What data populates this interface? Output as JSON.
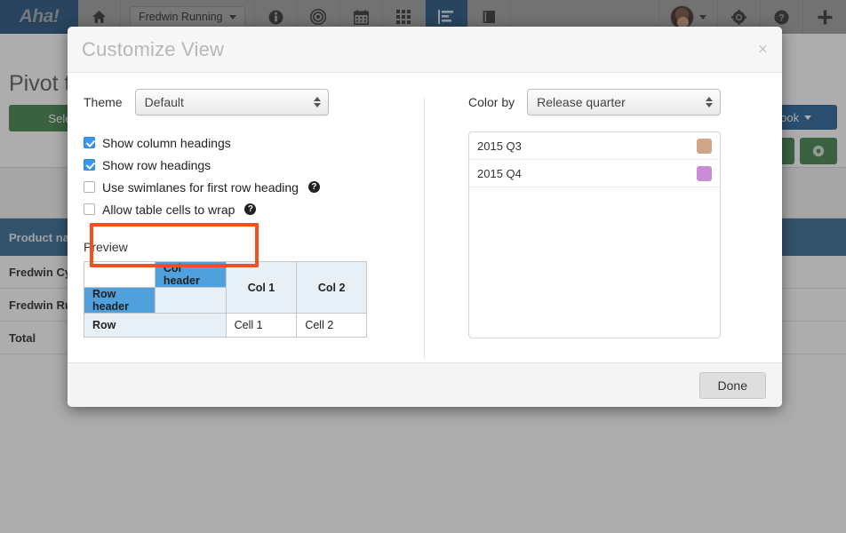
{
  "topbar": {
    "logo": "Aha!",
    "project_label": "Fredwin Running",
    "nav_items": [
      {
        "name": "home-icon",
        "label": "Home"
      },
      {
        "name": "info-icon",
        "label": "Strategy"
      },
      {
        "name": "target-icon",
        "label": "Goals"
      },
      {
        "name": "calendar-icon",
        "label": "Releases"
      },
      {
        "name": "grid-icon",
        "label": "Features"
      },
      {
        "name": "report-icon",
        "label": "Reports",
        "active": true
      },
      {
        "name": "book-icon",
        "label": "Notebooks"
      }
    ],
    "gear_label": "Settings",
    "help_label": "Help",
    "add_label": "Add"
  },
  "background": {
    "page_title": "Pivot ta",
    "select_data_label": "Select D",
    "notebook_label": "otebook",
    "table": {
      "header": "Product nam",
      "rows": [
        "Fredwin Cy",
        "Fredwin Ru",
        "Total"
      ]
    }
  },
  "modal": {
    "title": "Customize View",
    "close_label": "×",
    "theme": {
      "label": "Theme",
      "value": "Default"
    },
    "checkboxes": [
      {
        "label": "Show column headings",
        "checked": true,
        "help": false
      },
      {
        "label": "Show row headings",
        "checked": true,
        "help": false
      },
      {
        "label": "Use swimlanes for first row heading",
        "checked": false,
        "help": true
      },
      {
        "label": "Allow table cells to wrap",
        "checked": false,
        "help": true
      }
    ],
    "help_glyph": "?",
    "preview": {
      "label": "Preview",
      "col_header": "Col header",
      "row_header": "Row header",
      "col1": "Col 1",
      "col2": "Col 2",
      "row": "Row",
      "cell1": "Cell 1",
      "cell2": "Cell 2"
    },
    "color_by": {
      "label": "Color by",
      "value": "Release quarter",
      "items": [
        {
          "label": "2015 Q3",
          "color": "#cfa68a"
        },
        {
          "label": "2015 Q4",
          "color": "#cc8cd8"
        }
      ]
    },
    "done_label": "Done"
  },
  "colors": {
    "brand_blue": "#1b4a77",
    "accent_blue": "#4fa0dd",
    "highlight_red": "#f4501e",
    "checkbox_blue": "#3a97f0",
    "green_button": "#3a7d44"
  }
}
